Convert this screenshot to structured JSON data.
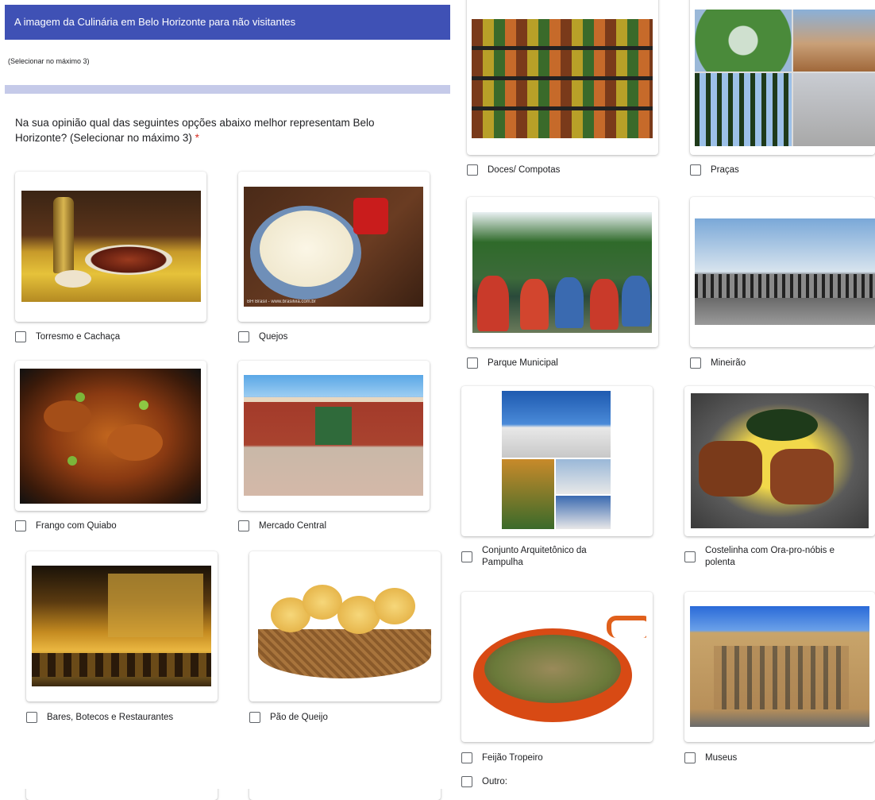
{
  "form": {
    "title": "A imagem da Culinária em Belo Horizonte para não visitantes",
    "subnote": "(Selecionar no máximo 3)",
    "question": "Na sua opinião qual das seguintes opções abaixo melhor representam Belo Horizonte? (Selecionar no máximo 3)",
    "required_mark": "*"
  },
  "options": [
    {
      "label": "Torresmo e Cachaça",
      "checked": false
    },
    {
      "label": "Quejos",
      "checked": false
    },
    {
      "label": "Frango com Quiabo",
      "checked": false
    },
    {
      "label": "Mercado Central",
      "checked": false
    },
    {
      "label": "Bares, Botecos e Restaurantes",
      "checked": false
    },
    {
      "label": "Pão de Queijo",
      "checked": false
    },
    {
      "label": "Doces/ Compotas",
      "checked": false
    },
    {
      "label": "Praças",
      "checked": false
    },
    {
      "label": "Parque Municipal",
      "checked": false
    },
    {
      "label": "Mineirão",
      "checked": false
    },
    {
      "label": "Conjunto Arquitetônico da Pampulha",
      "checked": false
    },
    {
      "label": "Costelinha com Ora-pro-nóbis e polenta",
      "checked": false
    },
    {
      "label": "Feijão Tropeiro",
      "checked": false
    },
    {
      "label": "Museus",
      "checked": false
    },
    {
      "label": "Outro:",
      "checked": false
    }
  ],
  "watermark": "BH Brasil - www.brasilvia.com.br"
}
